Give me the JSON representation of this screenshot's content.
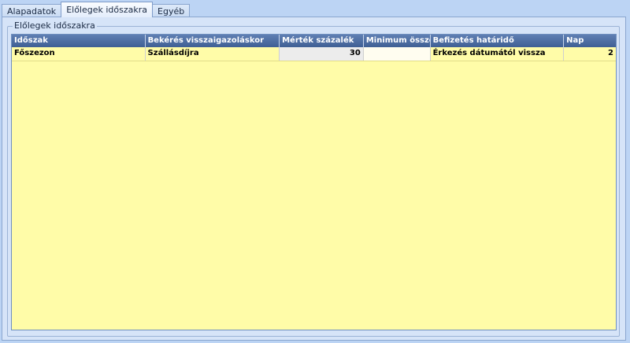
{
  "tabs": [
    {
      "label": "Alapadatok",
      "active": false
    },
    {
      "label": "Előlegek időszakra",
      "active": true
    },
    {
      "label": "Egyéb",
      "active": false
    }
  ],
  "group": {
    "title": "Előlegek időszakra"
  },
  "table": {
    "columns": [
      "Időszak",
      "Bekérés visszaigazoláskor",
      "Mérték százalék",
      "Minimum összeg",
      "Befizetés határidő",
      "Nap"
    ],
    "rows": [
      [
        "Főszezon",
        "Szállásdíjra",
        "30",
        "",
        "Érkezés dátumától vissza",
        "2"
      ]
    ]
  },
  "colors": {
    "background": "#bcd4f4",
    "grid_background": "#fffca8",
    "header_background": "#4f6fa4",
    "header_text": "#ffffff"
  }
}
